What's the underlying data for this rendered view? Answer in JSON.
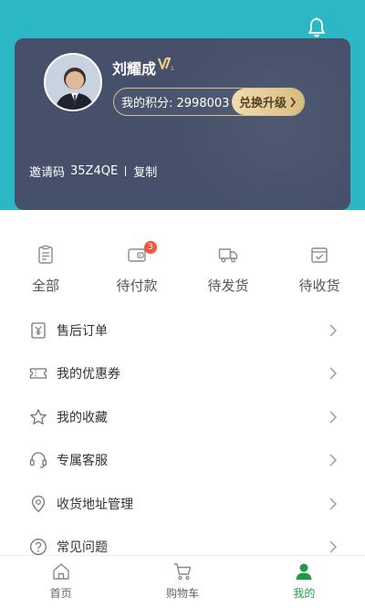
{
  "profile": {
    "name": "刘耀成",
    "vip_level": "1",
    "points_text": "我的积分: 2998003",
    "exchange_label": "兑换升级",
    "invite_label": "邀请码",
    "invite_code": "35Z4QE",
    "copy_label": "复制"
  },
  "orders": [
    {
      "label": "全部",
      "icon": "clipboard-icon"
    },
    {
      "label": "待付款",
      "icon": "wallet-icon",
      "badge": "3"
    },
    {
      "label": "待发货",
      "icon": "truck-icon"
    },
    {
      "label": "待收货",
      "icon": "box-check-icon"
    }
  ],
  "menu": [
    {
      "label": "售后订单",
      "icon": "yen-receipt-icon"
    },
    {
      "label": "我的优惠券",
      "icon": "coupon-icon"
    },
    {
      "label": "我的收藏",
      "icon": "star-icon"
    },
    {
      "label": "专属客服",
      "icon": "headset-icon"
    },
    {
      "label": "收货地址管理",
      "icon": "location-pin-icon"
    },
    {
      "label": "常见问题",
      "icon": "question-circle-icon"
    }
  ],
  "tabbar": [
    {
      "label": "首页",
      "icon": "home-icon"
    },
    {
      "label": "购物车",
      "icon": "cart-icon"
    },
    {
      "label": "我的",
      "icon": "user-icon",
      "active": true
    }
  ],
  "colors": {
    "header_teal": "#2bb7c3",
    "card_bg": "#46506a",
    "gold": "#d9b979",
    "active_green": "#1e9a4a",
    "badge_red": "#ef5a3c"
  }
}
